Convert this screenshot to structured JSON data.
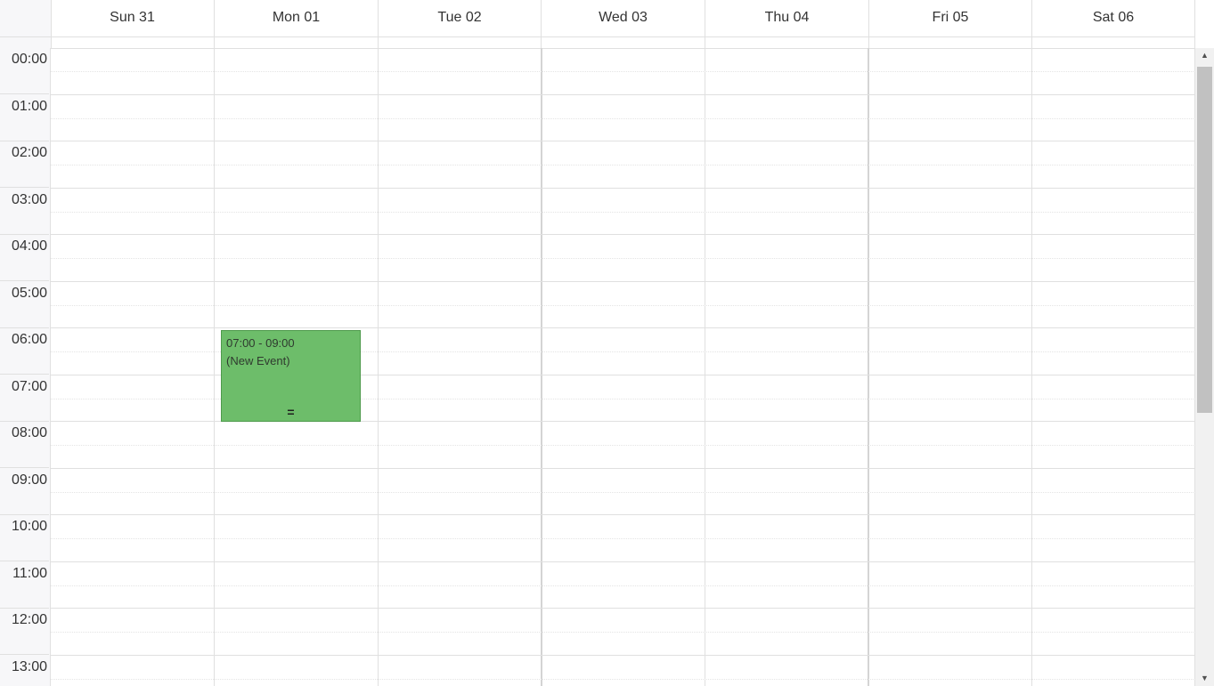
{
  "week": {
    "days": [
      {
        "label": "Sun 31"
      },
      {
        "label": "Mon 01"
      },
      {
        "label": "Tue 02"
      },
      {
        "label": "Wed 03"
      },
      {
        "label": "Thu 04"
      },
      {
        "label": "Fri 05"
      },
      {
        "label": "Sat 06"
      }
    ]
  },
  "hours": [
    "00:00",
    "01:00",
    "02:00",
    "03:00",
    "04:00",
    "05:00",
    "06:00",
    "07:00",
    "08:00",
    "09:00",
    "10:00",
    "11:00",
    "12:00",
    "13:00"
  ],
  "events": [
    {
      "day": "Mon 01",
      "time": "07:00 - 09:00",
      "title": "(New Event)",
      "resize_handle": "=",
      "color": "#6dbd6a"
    }
  ],
  "scrollbar": {
    "up_arrow": "▲",
    "down_arrow": "▼"
  },
  "colors": {
    "grid_line": "#e0e0e0",
    "gutter_bg": "#f7f7f9",
    "event_bg": "#6dbd6a",
    "event_border": "#4d9a4b",
    "text": "#333333"
  }
}
